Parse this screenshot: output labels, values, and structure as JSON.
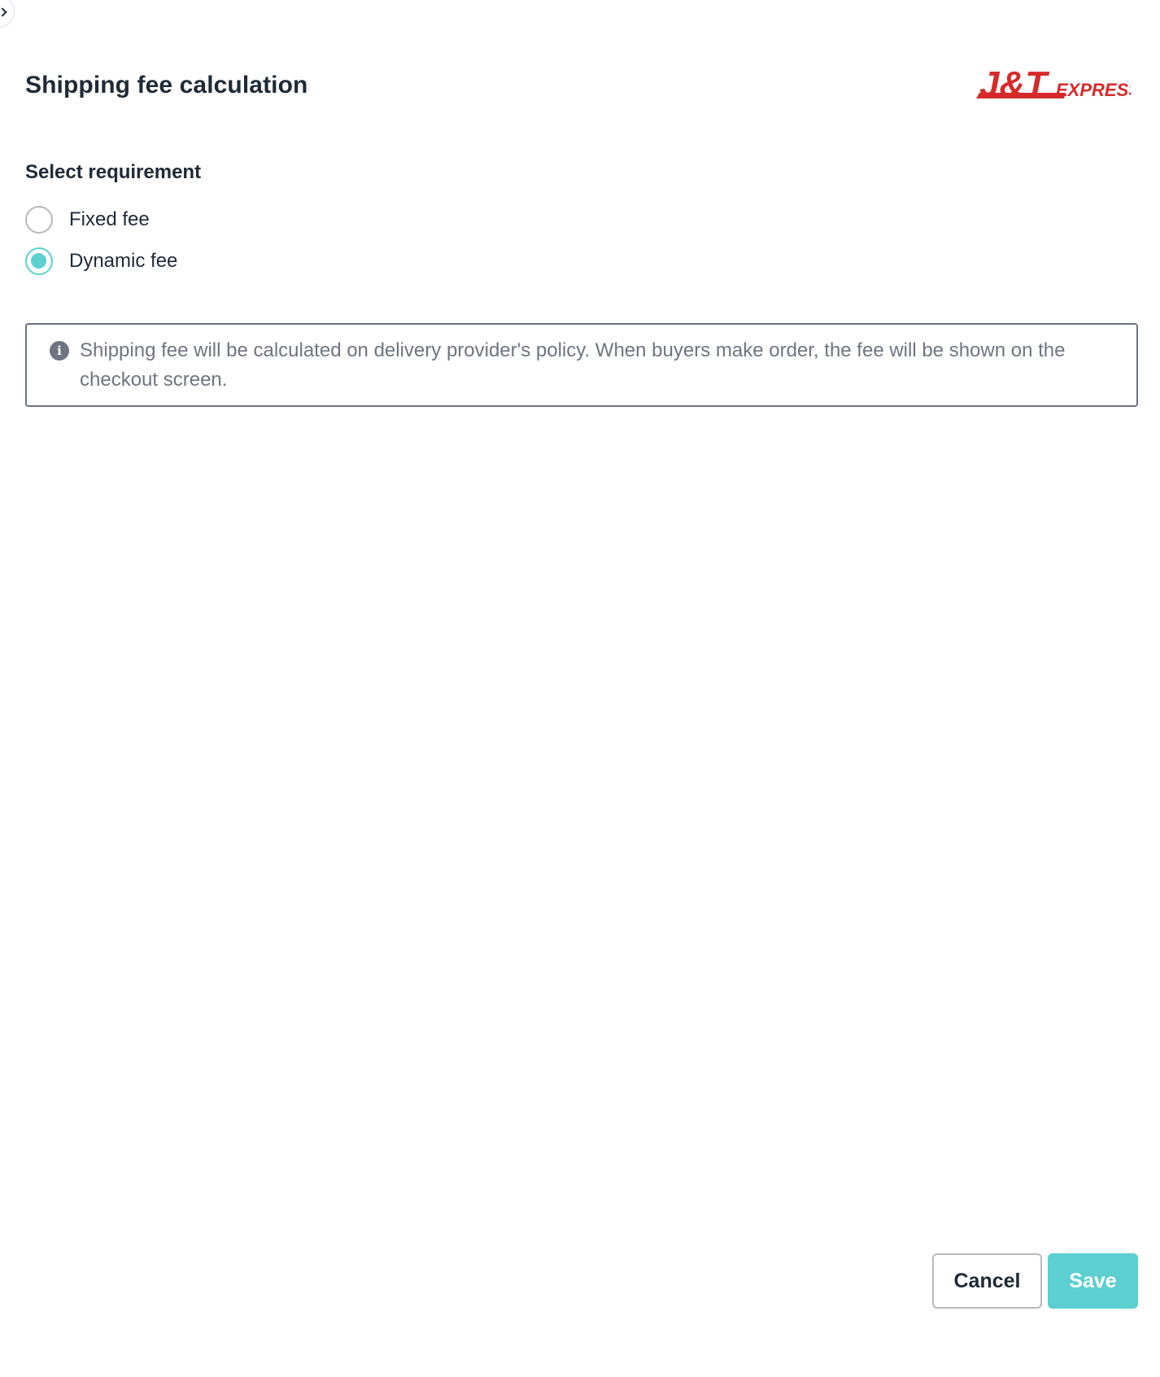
{
  "header": {
    "title": "Shipping fee calculation",
    "brand_logo": {
      "name": "J&T EXPRESS",
      "text_main": "J&T",
      "text_sub": "EXPRESS",
      "color": "#d62a2a"
    }
  },
  "requirement": {
    "label": "Select requirement",
    "options": [
      {
        "label": "Fixed fee",
        "selected": false
      },
      {
        "label": "Dynamic fee",
        "selected": true
      }
    ],
    "accent_color": "#5ccfd0"
  },
  "info": {
    "icon": "info-icon",
    "text": "Shipping fee will be calculated on delivery provider's policy. When buyers make order, the fee will be shown on the checkout screen."
  },
  "footer": {
    "cancel_label": "Cancel",
    "save_label": "Save"
  }
}
